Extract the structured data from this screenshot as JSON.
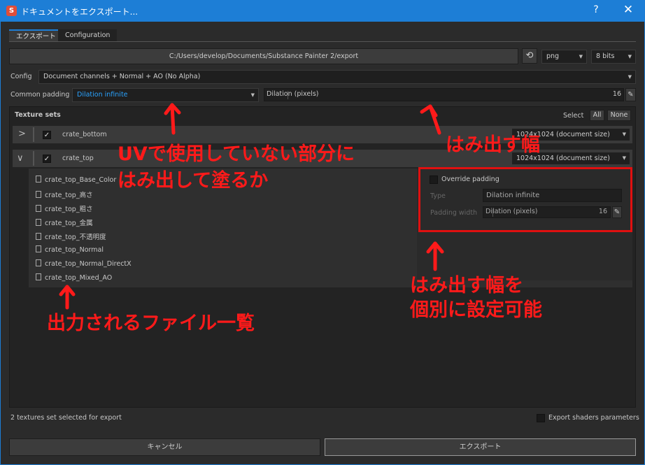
{
  "window": {
    "title": "ドキュメントをエクスポート...",
    "help": "?",
    "close": "✕",
    "logo": "S"
  },
  "tabs": [
    "エクスポート",
    "Configuration"
  ],
  "export_path": "C:/Users/develop/Documents/Substance Painter 2/export",
  "refresh_icon": "refresh-icon",
  "format": "png",
  "bit_depth": "8 bits",
  "config": {
    "label": "Config",
    "value": "Document channels + Normal + AO (No Alpha)"
  },
  "padding": {
    "label": "Common padding",
    "value": "Dilation infinite",
    "slider_label": "Dilation (pixels)",
    "slider_value": "16"
  },
  "texture_sets": {
    "title": "Texture sets",
    "select_label": "Select",
    "all": "All",
    "none": "None",
    "sets": [
      {
        "name": "crate_bottom",
        "checked": true,
        "expanded": false,
        "size": "1024x1024 (document size)"
      },
      {
        "name": "crate_top",
        "checked": true,
        "expanded": true,
        "size": "1024x1024 (document size)"
      }
    ],
    "files": [
      "crate_top_Base_Color",
      "crate_top_高さ",
      "crate_top_粗さ",
      "crate_top_金属",
      "crate_top_不透明度",
      "crate_top_Normal",
      "crate_top_Normal_DirectX",
      "crate_top_Mixed_AO"
    ],
    "override": {
      "label": "Override padding",
      "type_label": "Type",
      "type_value": "Dilation infinite",
      "width_label": "Padding width",
      "width_slider": "Dilation (pixels)",
      "width_value": "16"
    }
  },
  "status": "2 textures set selected for export",
  "export_shaders": "Export shaders parameters",
  "buttons": {
    "cancel": "キャンセル",
    "export": "エクスポート"
  },
  "annotations": {
    "uv_line1": "UVで使用していない部分に",
    "uv_line2": "はみ出して塗るか",
    "dilation": "はみ出す幅",
    "per_set_line1": "はみ出す幅を",
    "per_set_line2": "個別に設定可能",
    "file_list": "出力されるファイル一覧"
  },
  "colors": {
    "accent": "#1d7ed6",
    "annotation": "#ff1a1a",
    "highlight_text": "#2aa3ff"
  }
}
